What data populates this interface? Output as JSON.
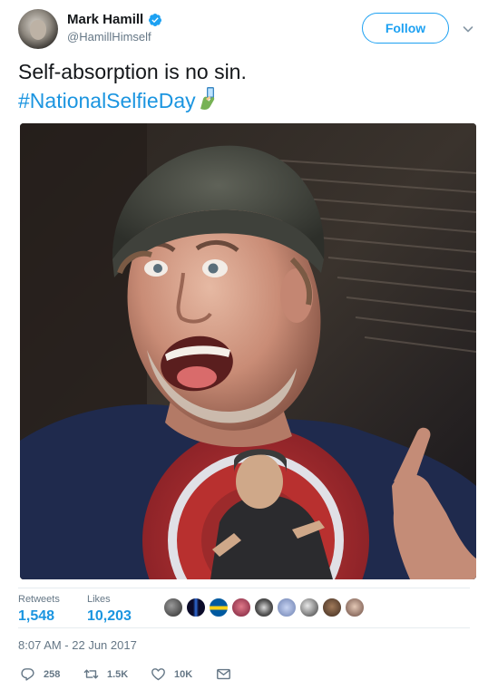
{
  "author": {
    "display_name": "Mark Hamill",
    "handle": "@HamillHimself",
    "verified": true,
    "avatar_icon": "profile-avatar"
  },
  "follow_button": {
    "label": "Follow"
  },
  "menu_icon": "chevron-down-icon",
  "tweet": {
    "line1": "Self-absorption is no sin.",
    "hashtag": "#NationalSelfieDay",
    "emoji": "selfie-emoji"
  },
  "photo": {
    "kind": "selfie-photo"
  },
  "stats": {
    "retweets_label": "Retweets",
    "retweets_value": "1,548",
    "likes_label": "Likes",
    "likes_value": "10,203",
    "liker_count_shown": 9
  },
  "timestamp": "8:07 AM - 22 Jun 2017",
  "actions": {
    "reply_count": "258",
    "retweet_count": "1.5K",
    "like_count": "10K",
    "message_icon": "envelope-icon"
  },
  "colors": {
    "accent": "#1da1f2",
    "link": "#1b95e0",
    "muted": "#657786",
    "text": "#14171a",
    "divider": "#e6ecf0"
  }
}
